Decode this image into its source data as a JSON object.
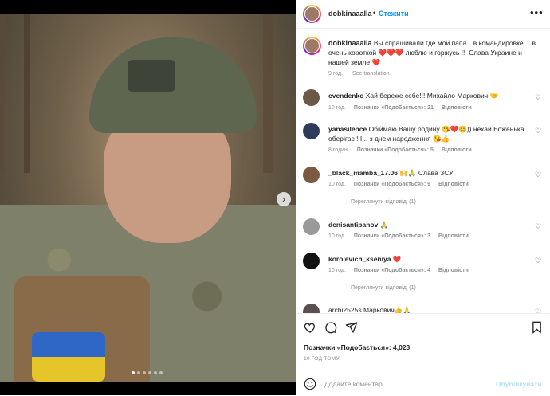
{
  "post": {
    "username": "dobkinaaalla",
    "follow_label": "Стежити",
    "more_label": "•••",
    "photo_dots": 6,
    "photo_active_dot": 0,
    "next_label": "›"
  },
  "caption": {
    "username": "dobkinaaalla",
    "text": " Вы спрашивали где мой папа…в командировке… в очень короткой ❤️❤️❤️ люблю и горжусь !!! Слава Украине и нашей земле ❤️",
    "time": "9 год.",
    "translate_label": "See translation"
  },
  "comments": [
    {
      "username": "evendenko",
      "text": " Хай береже себе!!! Михайло Маркович 🤝",
      "time": "10 год.",
      "likes": "Позначки «Подобається»: 21",
      "reply_label": "Відповісти",
      "avatar_color": "#6b5a48"
    },
    {
      "username": "yanasilence",
      "text": " Обіймаю Вашу родину 😘❤️😊)) нехай Боженька оберігає ! І... з днем народження 😘👍",
      "time": "8 годин.",
      "likes": "Позначки «Подобається»: 5",
      "reply_label": "Відповісти",
      "avatar_color": "#2f3a5a"
    },
    {
      "username": "_black_mamba_17.06",
      "text": " 🙌🙏 Слава ЗСУ!",
      "time": "10 год.",
      "likes": "Позначки «Подобається»: 9",
      "reply_label": "Відповісти",
      "view_replies": "Переглянути відповіді (1)",
      "avatar_color": "#7a5a40"
    },
    {
      "username": "denisantipanov",
      "text": " 🙏",
      "time": "10 год.",
      "likes": "Позначки «Подобається»: 3",
      "reply_label": "Відповісти",
      "avatar_color": "#9a9a9a"
    },
    {
      "username": "korolevich_kseniya",
      "text": " ❤️",
      "time": "10 год.",
      "likes": "Позначки «Подобається»: 4",
      "reply_label": "Відповісти",
      "view_replies": "Переглянути відповіді (1)",
      "avatar_color": "#111111"
    },
    {
      "username": "archi2525s",
      "text": " Маркович👍🙏",
      "time": "",
      "likes": "",
      "reply_label": "",
      "avatar_color": "#5a5050"
    }
  ],
  "footer": {
    "likes": "Позначки «Подобається»: 4,023",
    "time": "10 ГОД ТОМУ",
    "comment_placeholder": "Додайте коментар...",
    "post_label": "Опублікувати"
  },
  "colors": {
    "link_blue": "#0095f6",
    "post_disabled": "#b2dffc",
    "text": "#262626",
    "muted": "#8e8e8e"
  },
  "icons": [
    "heart-icon",
    "comment-icon",
    "share-icon",
    "bookmark-icon",
    "emoji-icon",
    "more-icon",
    "next-arrow-icon"
  ]
}
